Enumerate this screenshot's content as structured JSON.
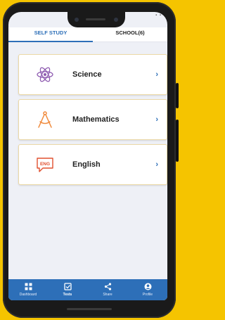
{
  "tabs": {
    "self_study": "SELF STUDY",
    "school": "SCHOOL(6)"
  },
  "subjects": [
    {
      "label": "Science",
      "icon": "atom-icon",
      "color": "#8e5bb0"
    },
    {
      "label": "Mathematics",
      "icon": "compass-icon",
      "color": "#f08a3c"
    },
    {
      "label": "English",
      "icon": "eng-speech-icon",
      "color": "#e0502f"
    }
  ],
  "subjects_chevron": "›",
  "english_icon_text": "ENG",
  "bottom_nav": [
    {
      "label": "Dashboard",
      "icon": "dashboard-icon"
    },
    {
      "label": "Tests",
      "icon": "tests-icon"
    },
    {
      "label": "Share",
      "icon": "share-icon"
    },
    {
      "label": "Profile",
      "icon": "profile-icon"
    }
  ],
  "colors": {
    "accent": "#2d6fb8",
    "background": "#f5c400",
    "screen": "#eef0f6"
  }
}
